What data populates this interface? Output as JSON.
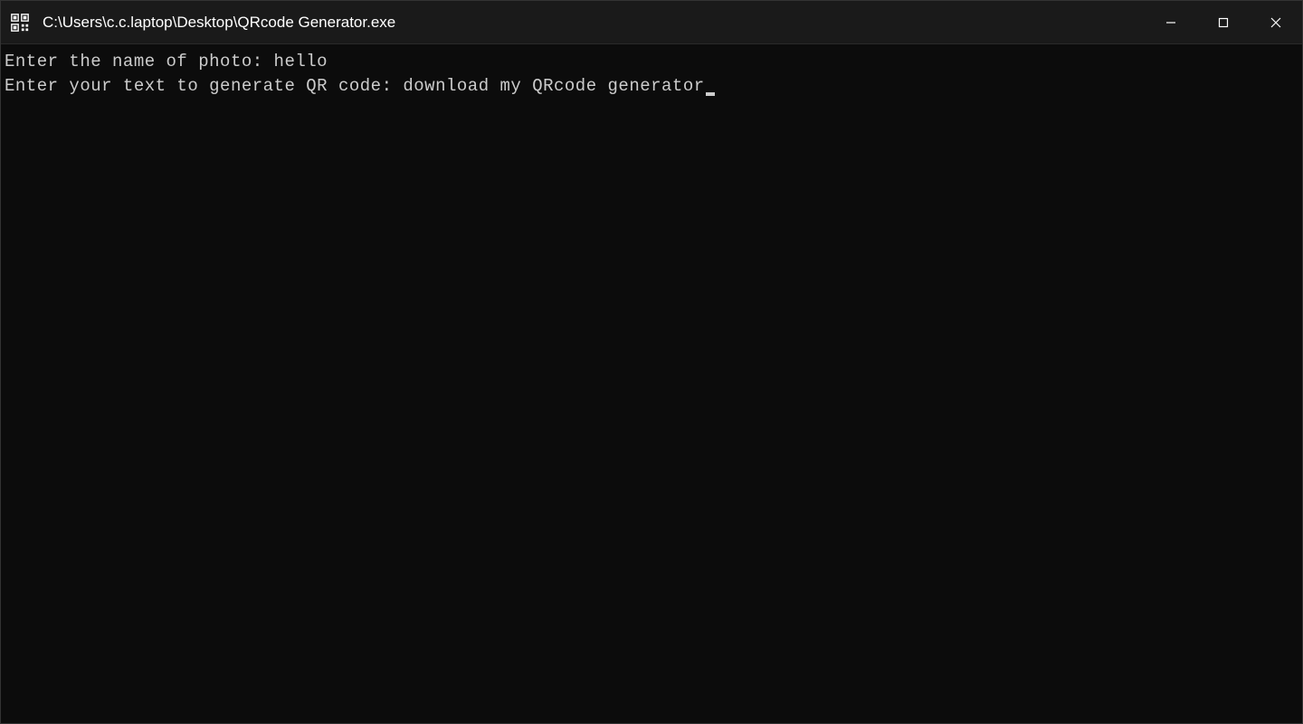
{
  "window": {
    "title": "C:\\Users\\c.c.laptop\\Desktop\\QRcode Generator.exe"
  },
  "terminal": {
    "lines": [
      {
        "prompt": "Enter the name of photo: ",
        "input": "hello",
        "cursor": false
      },
      {
        "prompt": "Enter your text to generate QR code: ",
        "input": "download my QRcode generator",
        "cursor": true
      }
    ]
  }
}
